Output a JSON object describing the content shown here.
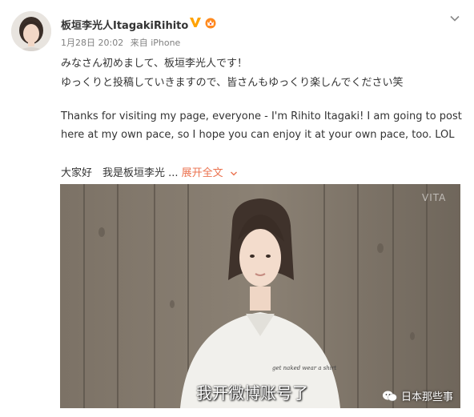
{
  "post": {
    "username": "板垣李光人ItagakiRihito",
    "date": "1月28日 20:02",
    "source": "来自 iPhone",
    "lines": [
      "みなさん初めまして、板垣李光人です！",
      "ゆっくりと投稿していきますので、皆さんもゆっくり楽しんでください笑",
      "Thanks for visiting my page, everyone - I'm Rihito Itagaki! I am going to post",
      "here at my own pace, so I hope you can enjoy it at your own pace, too. LOL"
    ],
    "excerpt": "大家好　我是板垣李光 ...",
    "expand_label": "展开全文",
    "badges": [
      "verified-v-icon",
      "crown-badge-icon"
    ],
    "colors": {
      "accent": "#eb7350",
      "verified": "#ffa200",
      "meta": "#808080"
    }
  },
  "video": {
    "subtitle": "我开微博账号了",
    "channel_mark": "VITA",
    "watermark_text": "日本那些事",
    "shirt_print": "get naked wear a shirt"
  }
}
